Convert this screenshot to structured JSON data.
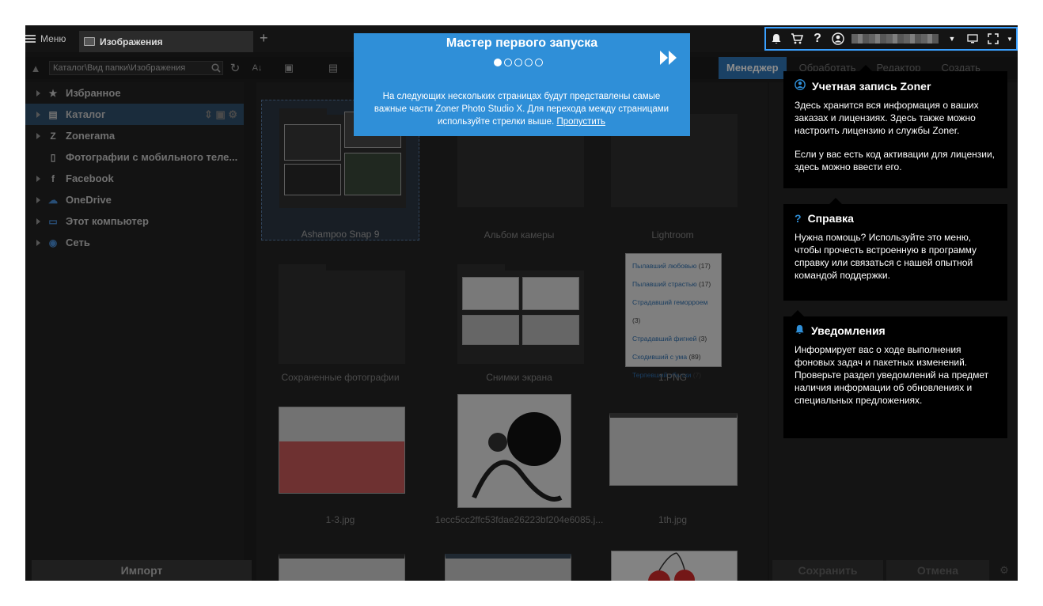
{
  "topbar": {
    "menu_label": "Меню",
    "tab_label": "Изображения",
    "add_tab": "+",
    "icons": [
      "bell-icon",
      "cart-icon",
      "help-icon",
      "user-icon",
      "chevron-down-icon",
      "monitor-icon",
      "fullscreen-icon"
    ]
  },
  "toolbar": {
    "path": "Каталог\\Вид папки\\Изображения",
    "modes": [
      "Менеджер",
      "Обработать",
      "Редактор",
      "Создать"
    ]
  },
  "sidebar": {
    "items": [
      {
        "label": "Избранное",
        "icon": "star-icon"
      },
      {
        "label": "Каталог",
        "icon": "catalog-icon"
      },
      {
        "label": "Zonerama",
        "icon": "zonerama-icon"
      },
      {
        "label": "Фотографии с мобильного теле...",
        "icon": "phone-icon"
      },
      {
        "label": "Facebook",
        "icon": "facebook-icon"
      },
      {
        "label": "OneDrive",
        "icon": "cloud-icon"
      },
      {
        "label": "Этот компьютер",
        "icon": "computer-icon"
      },
      {
        "label": "Сеть",
        "icon": "network-icon"
      }
    ],
    "import_label": "Импорт"
  },
  "grid": {
    "items": [
      "Ashampoo Snap 9",
      "Альбом камеры",
      "Lightroom",
      "Сохраненные фотографии",
      "Снимки экрана",
      "1.PNG",
      "1-3.jpg",
      "1ecc5cc2ffc53fdae26223bf204e6085.j...",
      "1th.jpg"
    ],
    "png_lines": [
      {
        "t": "Пылавший любовью",
        "n": "(17)"
      },
      {
        "t": "Пылавший страстью",
        "n": "(17)"
      },
      {
        "t": "Страдавший геморроем",
        "n": "(3)"
      },
      {
        "t": "Страдавший фигней",
        "n": "(3)"
      },
      {
        "t": "Сходивший с ума",
        "n": "(89)"
      },
      {
        "t": "Терпевший убытки",
        "n": "(7)"
      }
    ]
  },
  "rpanel": {
    "save_label": "Сохранить",
    "cancel_label": "Отмена"
  },
  "wizard": {
    "title": "Мастер первого запуска",
    "text": "На следующих нескольких страницах будут представлены самые важные части Zoner Photo Studio X. Для перехода между страницами используйте стрелки выше.",
    "skip": "Пропустить",
    "page": 1,
    "pages": 5
  },
  "tips": {
    "account": {
      "title": "Учетная запись Zoner",
      "p1": "Здесь хранится вся информация о ваших заказах и лицензиях. Здесь также можно настроить лицензию и службы Zoner.",
      "p2": "Если у вас есть код активации для лицензии, здесь можно ввести его."
    },
    "help": {
      "title": "Справка",
      "p1": "Нужна помощь? Используйте это меню, чтобы прочесть встроенную в программу справку или связаться с нашей опытной командой поддержки."
    },
    "notify": {
      "title": "Уведомления",
      "p1": "Информирует вас о ходе выполнения фоновых задач и пакетных изменений. Проверьте раздел уведомлений на предмет наличия информации об обновлениях и специальных предложениях."
    }
  },
  "colors": {
    "accent": "#2f8fd8",
    "highlight_border": "#3aa0ff"
  }
}
